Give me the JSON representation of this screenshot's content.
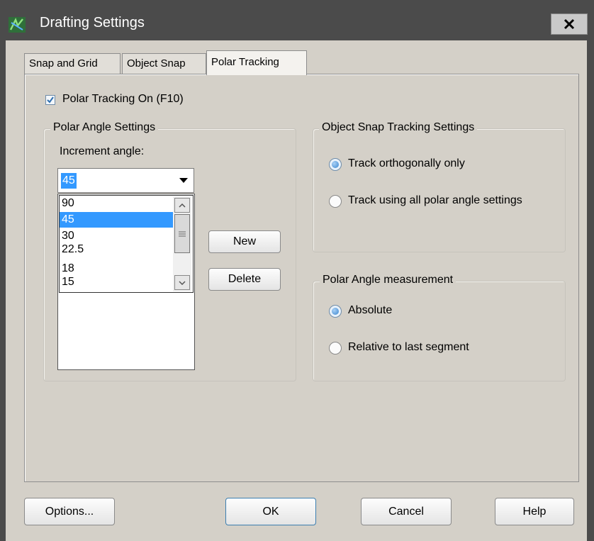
{
  "window": {
    "title": "Drafting Settings",
    "close_icon": "close-icon"
  },
  "tabs": [
    {
      "label": "Snap and Grid"
    },
    {
      "label": "Object Snap"
    },
    {
      "label": "Polar Tracking"
    }
  ],
  "polar_tracking_on": {
    "label": "Polar Tracking On (F10)",
    "checked": true
  },
  "polar_angle_settings": {
    "legend": "Polar Angle Settings",
    "increment_label": "Increment angle:",
    "increment_value": "45",
    "options": [
      "90",
      "45",
      "30",
      "22.5",
      "18",
      "15"
    ],
    "selected_option": "45",
    "new_label": "New",
    "delete_label": "Delete"
  },
  "object_snap_tracking": {
    "legend": "Object Snap Tracking Settings",
    "options": [
      {
        "label": "Track orthogonally only",
        "selected": true
      },
      {
        "label": "Track using all polar angle settings",
        "selected": false
      }
    ]
  },
  "polar_angle_measurement": {
    "legend": "Polar Angle measurement",
    "options": [
      {
        "label": "Absolute",
        "selected": true
      },
      {
        "label": "Relative to last segment",
        "selected": false
      }
    ]
  },
  "buttons": {
    "options": "Options...",
    "ok": "OK",
    "cancel": "Cancel",
    "help": "Help"
  },
  "colors": {
    "dialog_bg": "#d4d0c8",
    "titlebar_bg": "#4b4b4b",
    "selection": "#3399ff"
  }
}
